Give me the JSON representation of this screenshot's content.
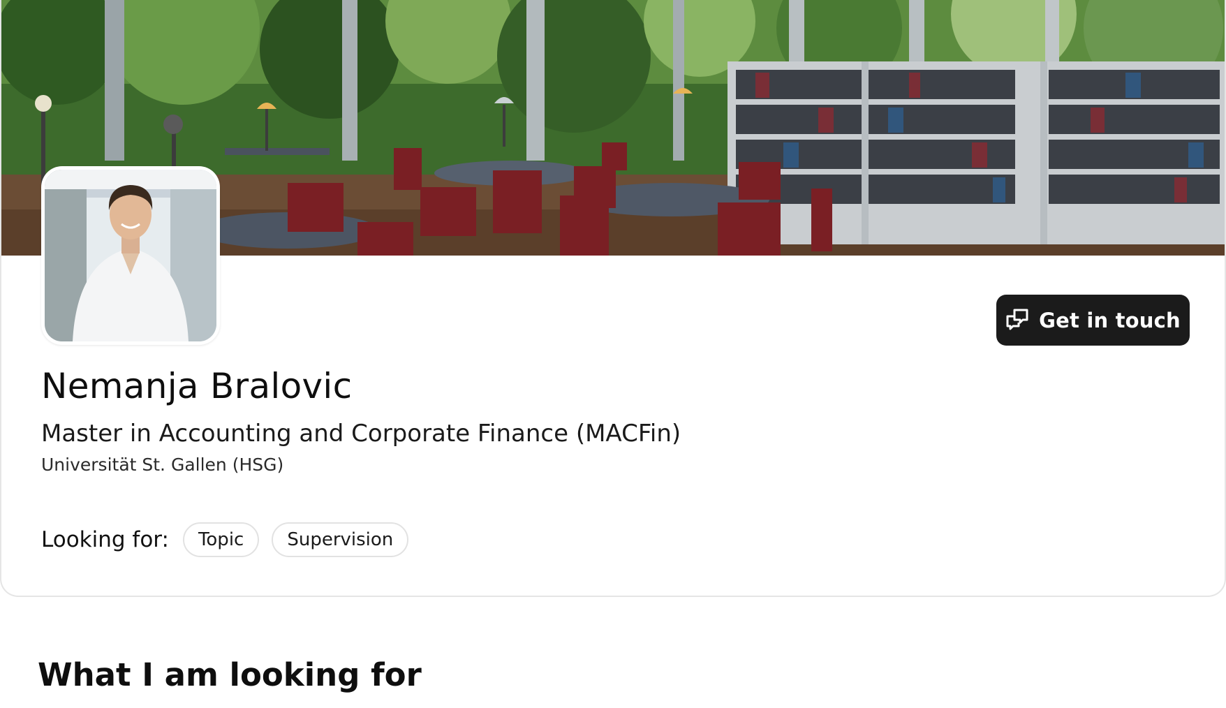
{
  "profile": {
    "name": "Nemanja Bralovic",
    "program": "Master in Accounting and Corporate Finance (MACFin)",
    "university": "Universität St. Gallen (HSG)",
    "cta_label": "Get in touch",
    "cta_icon": "chat-bubbles-icon",
    "looking_for": {
      "label": "Looking for:",
      "chips": [
        "Topic",
        "Supervision"
      ]
    }
  },
  "sections": {
    "what_looking_for_title": "What I am looking for"
  },
  "colors": {
    "button_bg": "#1b1b1b",
    "chip_border": "#e2e2e2",
    "card_border": "#e5e5e5"
  }
}
